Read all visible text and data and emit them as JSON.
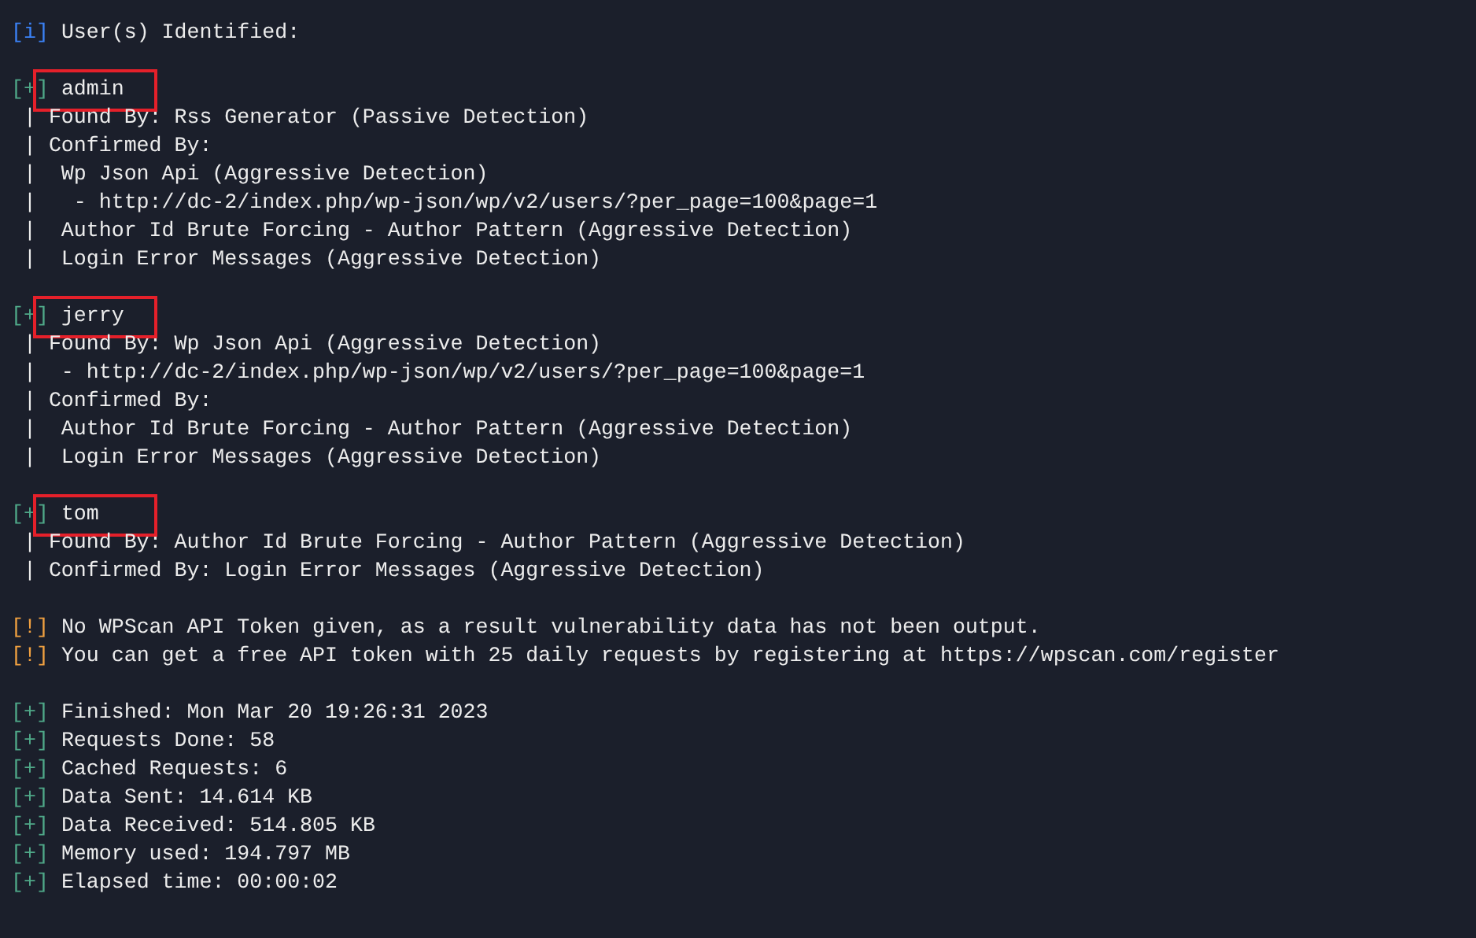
{
  "blocks": [
    {
      "lines": [
        {
          "kind": "info",
          "prefix": "[i]",
          "text": "User(s) Identified:",
          "highlighted": false
        }
      ]
    },
    {
      "lines": [
        {
          "kind": "plus",
          "prefix": "[+]",
          "text": "admin",
          "highlighted": true
        },
        {
          "kind": "plain",
          "text": " | Found By: Rss Generator (Passive Detection)",
          "highlighted": false
        },
        {
          "kind": "plain",
          "text": " | Confirmed By:",
          "highlighted": false
        },
        {
          "kind": "plain",
          "text": " |  Wp Json Api (Aggressive Detection)",
          "highlighted": false
        },
        {
          "kind": "plain",
          "text": " |   - http://dc-2/index.php/wp-json/wp/v2/users/?per_page=100&page=1",
          "highlighted": false
        },
        {
          "kind": "plain",
          "text": " |  Author Id Brute Forcing - Author Pattern (Aggressive Detection)",
          "highlighted": false
        },
        {
          "kind": "plain",
          "text": " |  Login Error Messages (Aggressive Detection)",
          "highlighted": false
        }
      ]
    },
    {
      "lines": [
        {
          "kind": "plus",
          "prefix": "[+]",
          "text": "jerry",
          "highlighted": true
        },
        {
          "kind": "plain",
          "text": " | Found By: Wp Json Api (Aggressive Detection)",
          "highlighted": false
        },
        {
          "kind": "plain",
          "text": " |  - http://dc-2/index.php/wp-json/wp/v2/users/?per_page=100&page=1",
          "highlighted": false
        },
        {
          "kind": "plain",
          "text": " | Confirmed By:",
          "highlighted": false
        },
        {
          "kind": "plain",
          "text": " |  Author Id Brute Forcing - Author Pattern (Aggressive Detection)",
          "highlighted": false
        },
        {
          "kind": "plain",
          "text": " |  Login Error Messages (Aggressive Detection)",
          "highlighted": false
        }
      ]
    },
    {
      "lines": [
        {
          "kind": "plus",
          "prefix": "[+]",
          "text": "tom",
          "highlighted": true
        },
        {
          "kind": "plain",
          "text": " | Found By: Author Id Brute Forcing - Author Pattern (Aggressive Detection)",
          "highlighted": false
        },
        {
          "kind": "plain",
          "text": " | Confirmed By: Login Error Messages (Aggressive Detection)",
          "highlighted": false
        }
      ]
    },
    {
      "lines": [
        {
          "kind": "warn",
          "prefix": "[!]",
          "text": "No WPScan API Token given, as a result vulnerability data has not been output.",
          "highlighted": false
        },
        {
          "kind": "warn",
          "prefix": "[!]",
          "text": "You can get a free API token with 25 daily requests by registering at https://wpscan.com/register",
          "highlighted": false
        }
      ]
    },
    {
      "lines": [
        {
          "kind": "plus",
          "prefix": "[+]",
          "text": "Finished: Mon Mar 20 19:26:31 2023",
          "highlighted": false
        },
        {
          "kind": "plus",
          "prefix": "[+]",
          "text": "Requests Done: 58",
          "highlighted": false
        },
        {
          "kind": "plus",
          "prefix": "[+]",
          "text": "Cached Requests: 6",
          "highlighted": false
        },
        {
          "kind": "plus",
          "prefix": "[+]",
          "text": "Data Sent: 14.614 KB",
          "highlighted": false
        },
        {
          "kind": "plus",
          "prefix": "[+]",
          "text": "Data Received: 514.805 KB",
          "highlighted": false
        },
        {
          "kind": "plus",
          "prefix": "[+]",
          "text": "Memory used: 194.797 MB",
          "highlighted": false
        },
        {
          "kind": "plus",
          "prefix": "[+]",
          "text": "Elapsed time: 00:00:02",
          "highlighted": false
        }
      ]
    }
  ]
}
